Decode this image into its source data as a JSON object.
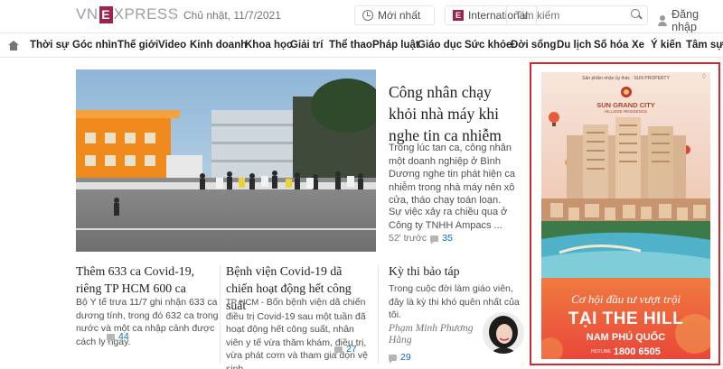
{
  "header": {
    "logo": {
      "pre": "VN",
      "box": "E",
      "post": "XPRESS"
    },
    "date": "Chủ nhật, 11/7/2021",
    "latest_label": "Mới nhất",
    "international_label": "International",
    "search_placeholder": "Tìm kiếm",
    "login_label": "Đăng nhập"
  },
  "nav": {
    "items": [
      "Thời sự",
      "Góc nhìn",
      "Thế giới",
      "Video",
      "Kinh doanh",
      "Khoa học",
      "Giải trí",
      "Thể thao",
      "Pháp luật",
      "Giáo dục",
      "Sức khỏe",
      "Đời sống",
      "Du lịch",
      "Số hóa",
      "Xe",
      "Ý kiến",
      "Tâm sự"
    ]
  },
  "hero": {
    "title": "Công nhân chạy khỏi nhà máy khi nghe tin ca nhiễm",
    "desc": "Trong lúc tan ca, công nhân một doanh nghiệp ở Bình Dương nghe tin phát hiện ca nhiễm trong nhà máy nên xô cửa, tháo chạy toán loạn.",
    "desc2": "Sự việc xảy ra chiều qua ở Công ty TNHH Ampacs ...",
    "time": "52' trước",
    "comments": "35"
  },
  "articles": [
    {
      "title": "Thêm 633 ca Covid-19, riêng TP HCM 600 ca",
      "desc": "Bộ Y tế trưa 11/7 ghi nhận 633 ca dương tính, trong đó 632 ca trong nước và một ca nhập cảnh được cách ly ngay.",
      "comments": "44"
    },
    {
      "title": "Bệnh viện Covid-19 dã chiến hoạt động hết công suất",
      "prefix": "TP HCM - ",
      "desc": "Bốn bệnh viện dã chiến điều trị Covid-19 sau một tuần đã hoạt động hết công suất, nhân viên y tế vừa thăm khám, điều trị, vừa phát cơm và tham gia dọn vệ sinh.",
      "comments": "27"
    },
    {
      "title": "Kỳ thi bảo táp",
      "desc": "Trong cuộc đời làm giáo viên, đây là kỳ thi khó quên nhất của tôi.",
      "author": "Phạm Minh Phương Hằng",
      "comments": "29"
    }
  ],
  "ad": {
    "tagline": "Sản phẩm nhận ủy thác",
    "developer": "SUN PROPERTY",
    "brand": "SUN GRAND CITY",
    "brand_sub": "HILLSIDE RESIDENCE",
    "slogan": "Cơ hội đầu tư vượt trội",
    "headline": "TẠI THE HILL",
    "location": "NAM PHÚ QUỐC",
    "hotline_label": "HOTLINE",
    "hotline": "1800 6505",
    "colors": {
      "sky": "#f2c9b5",
      "sea": "#4fb2c8",
      "banner": "#ef5b3e",
      "border": "#d8262c"
    }
  },
  "colors": {
    "brand": "#9f224e",
    "link": "#076db6"
  }
}
